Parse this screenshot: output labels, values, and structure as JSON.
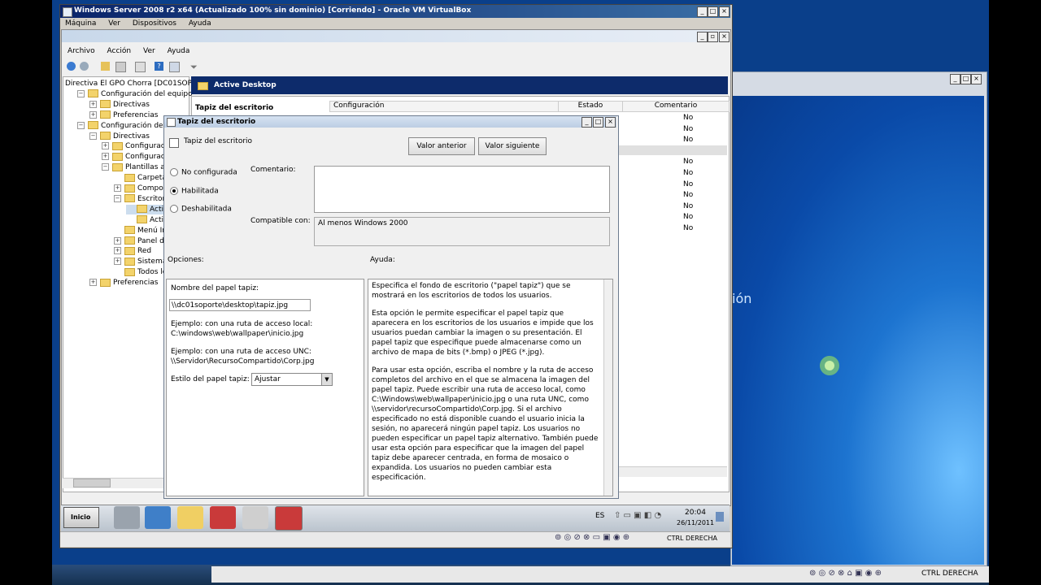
{
  "vbox": {
    "title": "Windows Server 2008 r2 x64 (Actualizado 100% sin dominio) [Corriendo] - Oracle VM VirtualBox",
    "menu": [
      "Máquina",
      "Ver",
      "Dispositivos",
      "Ayuda"
    ],
    "status_label": "CTRL DERECHA"
  },
  "gpedit": {
    "menu": [
      "Archivo",
      "Acción",
      "Ver",
      "Ayuda"
    ],
    "tree": [
      {
        "label": "Directiva El GPO Chorra [DC01SOP",
        "level": 0
      },
      {
        "label": "Configuración del equipo",
        "level": 1
      },
      {
        "label": "Directivas",
        "level": 2
      },
      {
        "label": "Preferencias",
        "level": 2
      },
      {
        "label": "Configuración de usuar",
        "level": 1
      },
      {
        "label": "Directivas",
        "level": 2
      },
      {
        "label": "Configuración d",
        "level": 3
      },
      {
        "label": "Configuración d",
        "level": 3
      },
      {
        "label": "Plantillas admin",
        "level": 3
      },
      {
        "label": "Carpetas c",
        "level": 4
      },
      {
        "label": "Componen",
        "level": 4
      },
      {
        "label": "Escritorio",
        "level": 4
      },
      {
        "label": "Active",
        "level": 5
      },
      {
        "label": "Active",
        "level": 5
      },
      {
        "label": "Menú Inicio",
        "level": 4
      },
      {
        "label": "Panel de co",
        "level": 4
      },
      {
        "label": "Red",
        "level": 4
      },
      {
        "label": "Sistema",
        "level": 4
      },
      {
        "label": "Todos los v",
        "level": 4
      },
      {
        "label": "Preferencias",
        "level": 2
      }
    ],
    "header": "Active Desktop",
    "left_heading": "Tapiz del escritorio",
    "columns": [
      "Configuración",
      "Estado",
      "Comentario"
    ],
    "comment_values": [
      "No",
      "No",
      "No",
      "No",
      "No",
      "No",
      "No",
      "No",
      "No",
      "No",
      "No"
    ]
  },
  "dialog": {
    "title": "Tapiz del escritorio",
    "setting_name": "Tapiz del escritorio",
    "prev_button": "Valor anterior",
    "next_button": "Valor siguiente",
    "radio_not_configured": "No configurada",
    "radio_enabled": "Habilitada",
    "radio_disabled": "Deshabilitada",
    "comment_label": "Comentario:",
    "supported_label": "Compatible con:",
    "supported_value": "Al menos Windows 2000",
    "options_label": "Opciones:",
    "help_label": "Ayuda:",
    "wallpaper_name_label": "Nombre del papel tapiz:",
    "wallpaper_path": "\\\\dc01soporte\\desktop\\tapiz.jpg",
    "example_local_label": "Ejemplo: con una ruta de acceso local:",
    "example_local_value": "C:\\windows\\web\\wallpaper\\inicio.jpg",
    "example_unc_label": "Ejemplo: con una ruta de acceso UNC:",
    "example_unc_value": "\\\\Servidor\\RecursoCompartido\\Corp.jpg",
    "style_label": "Estilo del papel tapiz:",
    "style_value": "Ajustar",
    "help_p1": "Especifica el fondo de escritorio (\"papel tapiz\") que se mostrará en los escritorios de todos los usuarios.",
    "help_p2": "Esta opción le permite especificar el papel tapiz que aparecera en los escritorios de los usuarios e impide que los usuarios puedan cambiar la imagen o su presentación. El papel tapiz que especifique puede almacenarse como un archivo de mapa de bits (*.bmp) o JPEG (*.jpg).",
    "help_p3": "Para usar esta opción, escriba el nombre y la ruta de acceso completos del archivo en el que se almacena la imagen del papel tapiz. Puede escribir una ruta de acceso local, como C:\\Windows\\web\\wallpaper\\inicio.jpg o una ruta UNC, como \\\\servidor\\recursoCompartido\\Corp.jpg. Si el archivo especificado no está disponible cuando el usuario inicia la sesión, no aparecerá ningún papel tapiz. Los usuarios no pueden especificar un papel tapiz alternativo. También puede usar esta opción para especificar que la imagen del papel tapiz debe aparecer centrada, en forma de mosaico o expandida. Los usuarios no pueden cambiar esta especificación."
  },
  "taskbar": {
    "start": "Inicio",
    "lang": "ES",
    "time": "20:04",
    "date": "26/11/2011"
  },
  "host_status": "CTRL DERECHA",
  "right_desktop_text": "ión"
}
